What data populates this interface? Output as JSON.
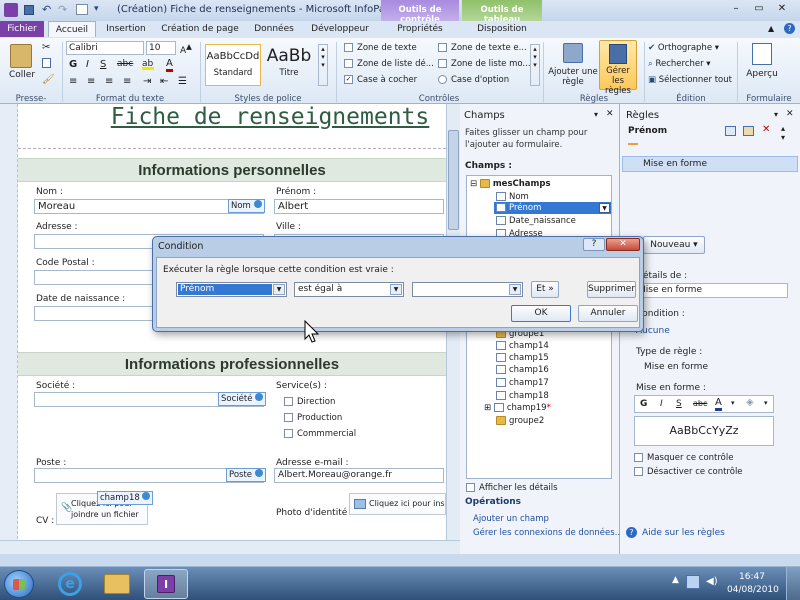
{
  "window": {
    "title": "(Création) Fiche de renseignements - Microsoft InfoPath",
    "context_tab_groups": [
      "Outils de contrôle",
      "Outils de tableau"
    ]
  },
  "ribbon": {
    "tabs": [
      "Fichier",
      "Accueil",
      "Insertion",
      "Création de page",
      "Données",
      "Développeur",
      "Propriétés",
      "Disposition"
    ],
    "clipboard": {
      "paste": "Coller",
      "group": "Presse-papiers"
    },
    "font": {
      "family": "Calibri",
      "size": "10",
      "group": "Format du texte"
    },
    "styles": {
      "normal_sample": "AaBbCcDd",
      "normal_label": "Standard",
      "title_sample": "AaBb",
      "title_label": "Titre",
      "group": "Styles de police"
    },
    "controls": {
      "items": [
        "Zone de texte",
        "Zone de texte e...",
        "Zone de liste dé...",
        "Zone de liste mo...",
        "Case à cocher",
        "Case d'option"
      ],
      "group": "Contrôles"
    },
    "rules": {
      "add": "Ajouter une règle",
      "manage": "Gérer les règles",
      "group": "Règles"
    },
    "editing": {
      "items": [
        "Orthographe",
        "Rechercher",
        "Sélectionner tout"
      ],
      "group": "Édition"
    },
    "form": {
      "preview": "Aperçu",
      "group": "Formulaire"
    }
  },
  "form": {
    "title": "Fiche de renseignements",
    "section1": "Informations personnelles",
    "section2": "Informations professionnelles",
    "labels": {
      "nom": "Nom :",
      "prenom": "Prénom :",
      "adresse": "Adresse :",
      "ville": "Ville :",
      "cp": "Code Postal :",
      "naissance": "Date de naissance :",
      "societe": "Société :",
      "services": "Service(s) :",
      "poste": "Poste :",
      "email": "Adresse e-mail :",
      "cv": "CV :",
      "photo": "Photo d'identité :"
    },
    "values": {
      "nom": "Moreau",
      "prenom": "Albert",
      "email": "Albert.Moreau@orange.fr"
    },
    "tags": {
      "nom": "Nom",
      "societe": "Société",
      "poste": "Poste",
      "champ18": "champ18"
    },
    "services": [
      "Direction",
      "Production",
      "Commmercial"
    ],
    "attach": "Cliquez ici pour joindre un fichier",
    "attach_photo": "Cliquez ici pour insé"
  },
  "champs": {
    "title": "Champs",
    "hint": "Faites glisser un champ pour l'ajouter au formulaire.",
    "label": "Champs :",
    "root": "mesChamps",
    "items_top": [
      "Nom",
      "Prénom",
      "Date_naissance",
      "Adresse"
    ],
    "items_bottom": [
      "groupe1",
      "champ14",
      "champ15",
      "champ16",
      "champ17",
      "champ18",
      "champ19",
      "groupe2"
    ],
    "show_details": "Afficher les détails",
    "operations": "Opérations",
    "links": [
      "Ajouter un champ",
      "Gérer les connexions de données..."
    ]
  },
  "regles": {
    "title": "Règles",
    "field": "Prénom",
    "rule_name": "Mise en forme",
    "new_btn": "Nouveau",
    "details_label": "Détails de :",
    "details_value": "Mise en forme",
    "condition_label": "Condition :",
    "condition_value": "Aucune",
    "type_label": "Type de règle :",
    "type_value": "Mise en forme",
    "format_label": "Mise en forme :",
    "format_sample": "AaBbCcYyZz",
    "hide": "Masquer ce contrôle",
    "disable": "Désactiver ce contrôle",
    "help": "Aide sur les règles"
  },
  "dialog": {
    "title": "Condition",
    "prompt": "Exécuter la règle lorsque cette condition est vraie :",
    "field": "Prénom",
    "operator": "est égal à",
    "value": "",
    "and_btn": "Et »",
    "delete_btn": "Supprimer",
    "ok": "OK",
    "cancel": "Annuler"
  },
  "taskbar": {
    "time": "16:47",
    "date": "04/08/2010"
  },
  "colors": {
    "accent_purple": "#7b3fa8",
    "ribbon_bg": "#dde8f5",
    "dialog_border": "#4a6ea8"
  }
}
